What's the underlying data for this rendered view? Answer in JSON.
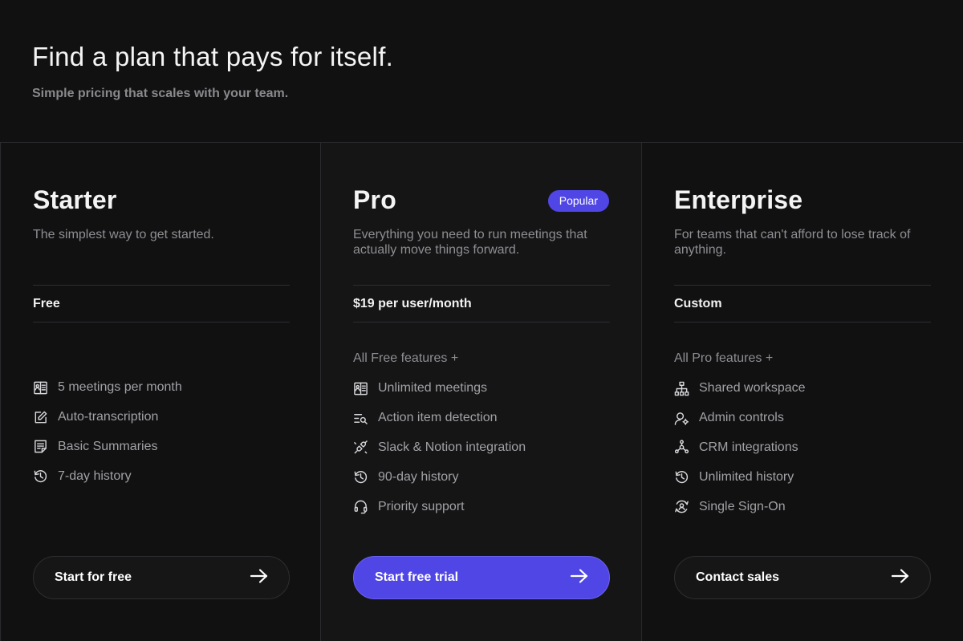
{
  "header": {
    "title": "Find a plan that pays for itself.",
    "subtitle": "Simple pricing that scales with your team."
  },
  "plans": [
    {
      "name": "Starter",
      "description": "The simplest way to get started.",
      "price": "Free",
      "features_heading": "",
      "features": [
        {
          "icon": "meetings-icon",
          "label": "5 meetings per month"
        },
        {
          "icon": "edit-icon",
          "label": "Auto-transcription"
        },
        {
          "icon": "summary-icon",
          "label": "Basic Summaries"
        },
        {
          "icon": "history-icon",
          "label": "7-day history"
        }
      ],
      "cta": "Start for free"
    },
    {
      "name": "Pro",
      "badge": "Popular",
      "description": "Everything you need to run meetings that actually move things forward.",
      "price": "$19 per user/month",
      "features_heading": "All Free features +",
      "features": [
        {
          "icon": "meetings-icon",
          "label": "Unlimited meetings"
        },
        {
          "icon": "action-search-icon",
          "label": "Action item detection"
        },
        {
          "icon": "plug-icon",
          "label": "Slack & Notion integration"
        },
        {
          "icon": "history-icon",
          "label": "90-day history"
        },
        {
          "icon": "headset-icon",
          "label": "Priority support"
        }
      ],
      "cta": "Start free trial"
    },
    {
      "name": "Enterprise",
      "description": "For teams that can't afford to lose track of anything.",
      "price": "Custom",
      "features_heading": "All Pro features +",
      "features": [
        {
          "icon": "network-icon",
          "label": "Shared workspace"
        },
        {
          "icon": "admin-user-icon",
          "label": "Admin controls"
        },
        {
          "icon": "crm-nodes-icon",
          "label": "CRM integrations"
        },
        {
          "icon": "history-icon",
          "label": "Unlimited history"
        },
        {
          "icon": "sso-icon",
          "label": "Single Sign-On"
        }
      ],
      "cta": "Contact sales"
    }
  ],
  "colors": {
    "background": "#111112",
    "accent": "#5046e5",
    "muted_text": "#8e8e93",
    "border": "#2a2a2d"
  }
}
